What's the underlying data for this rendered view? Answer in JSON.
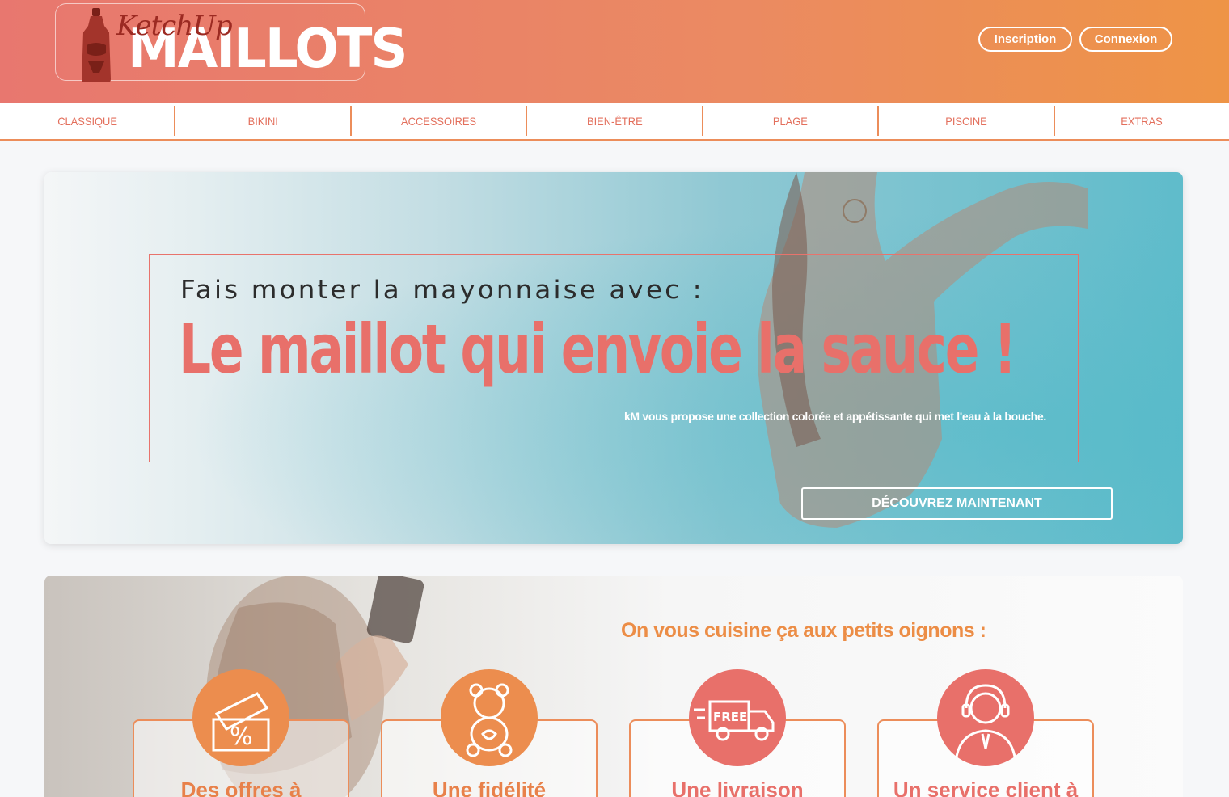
{
  "header": {
    "logo_ketchup": "KetchUp",
    "logo_maillots": "MAILLOTS",
    "inscription_label": "Inscription",
    "connexion_label": "Connexion"
  },
  "nav": {
    "items": [
      "CLASSIQUE",
      "BIKINI",
      "ACCESSOIRES",
      "BIEN-ÊTRE",
      "PLAGE",
      "PISCINE",
      "EXTRAS"
    ]
  },
  "hero": {
    "subtitle": "Fais monter la mayonnaise avec :",
    "title": "Le maillot qui envoie la sauce !",
    "description": "kM vous propose une collection colorée et appétissante qui met l'eau à la bouche.",
    "cta_label": "DÉCOUVREZ MAINTENANT"
  },
  "features": {
    "title": "On vous cuisine ça aux petits oignons :",
    "cards": [
      {
        "title": "Des offres à",
        "icon": "discount-ticket-icon"
      },
      {
        "title": "Une fidélité",
        "icon": "teddy-bear-icon"
      },
      {
        "title": "Une livraison",
        "icon": "free-delivery-truck-icon"
      },
      {
        "title": "Un service client à",
        "icon": "customer-support-icon"
      }
    ]
  },
  "colors": {
    "header_start": "#e8776f",
    "header_end": "#ee9446",
    "accent_orange": "#ec8d4e",
    "accent_coral": "#e8706a"
  }
}
